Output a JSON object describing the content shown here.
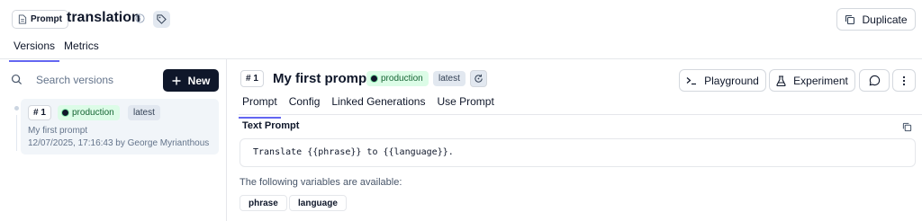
{
  "header": {
    "type_badge": "Prompt",
    "prompt_name": "translation",
    "duplicate_label": "Duplicate",
    "tabs": [
      "Versions",
      "Metrics"
    ]
  },
  "sidebar": {
    "search_placeholder": "Search versions",
    "new_label": "New",
    "versions": [
      {
        "number": "# 1",
        "label_production": "production",
        "label_latest": "latest",
        "name": "My first prompt",
        "meta": "12/07/2025, 17:16:43 by George Myrianthous"
      }
    ]
  },
  "main": {
    "version_number": "# 1",
    "title": "My first prompt",
    "label_production": "production",
    "label_latest": "latest",
    "playground_label": "Playground",
    "experiment_label": "Experiment",
    "tabs": [
      "Prompt",
      "Config",
      "Linked Generations",
      "Use Prompt"
    ],
    "section_label": "Text Prompt",
    "prompt_text": "Translate {{phrase}} to {{language}}.",
    "variables_text": "The following variables are available:",
    "variables": [
      "phrase",
      "language"
    ]
  },
  "colors": {
    "accent": "#6366f1",
    "production_bg": "#dcfce7",
    "production_text": "#166534",
    "primary_button": "#0f172a"
  },
  "icons": [
    "document-icon",
    "info-icon",
    "tag-icon",
    "copy-icon",
    "search-icon",
    "plus-icon",
    "sync-icon",
    "terminal-icon",
    "flask-icon",
    "comment-icon",
    "more-icon"
  ]
}
